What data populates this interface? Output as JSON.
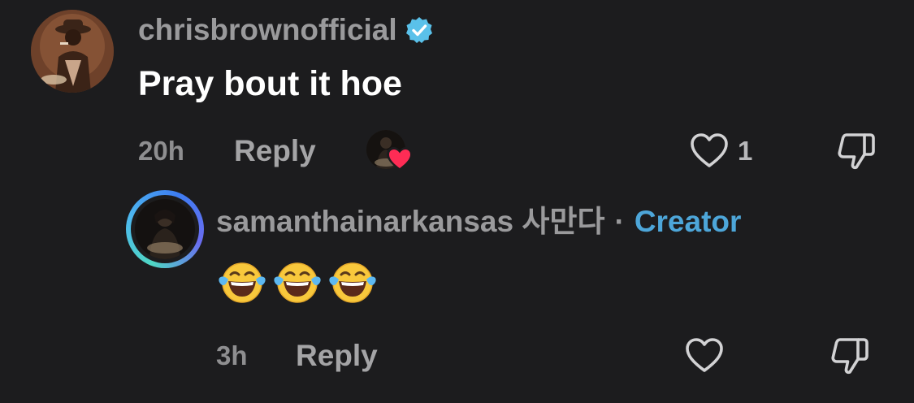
{
  "comment": {
    "username": "chrisbrownofficial",
    "verified_icon": "verified-badge-icon",
    "text": "Pray bout it hoe",
    "time": "20h",
    "reply_label": "Reply",
    "like_count": "1",
    "heart_icon": "heart-outline-icon",
    "dislike_icon": "thumbs-down-icon"
  },
  "reply_comment": {
    "username": "samanthainarkansas 사만다",
    "separator": "·",
    "creator_label": "Creator",
    "text_emojis": [
      "😂",
      "😂",
      "😂"
    ],
    "time": "3h",
    "reply_label": "Reply",
    "heart_icon": "heart-outline-icon",
    "dislike_icon": "thumbs-down-icon"
  },
  "colors": {
    "background": "#1c1c1e",
    "creator_blue": "#4da6d9",
    "liked_heart": "#fe2c55",
    "verified_blue": "#20d5ec"
  }
}
